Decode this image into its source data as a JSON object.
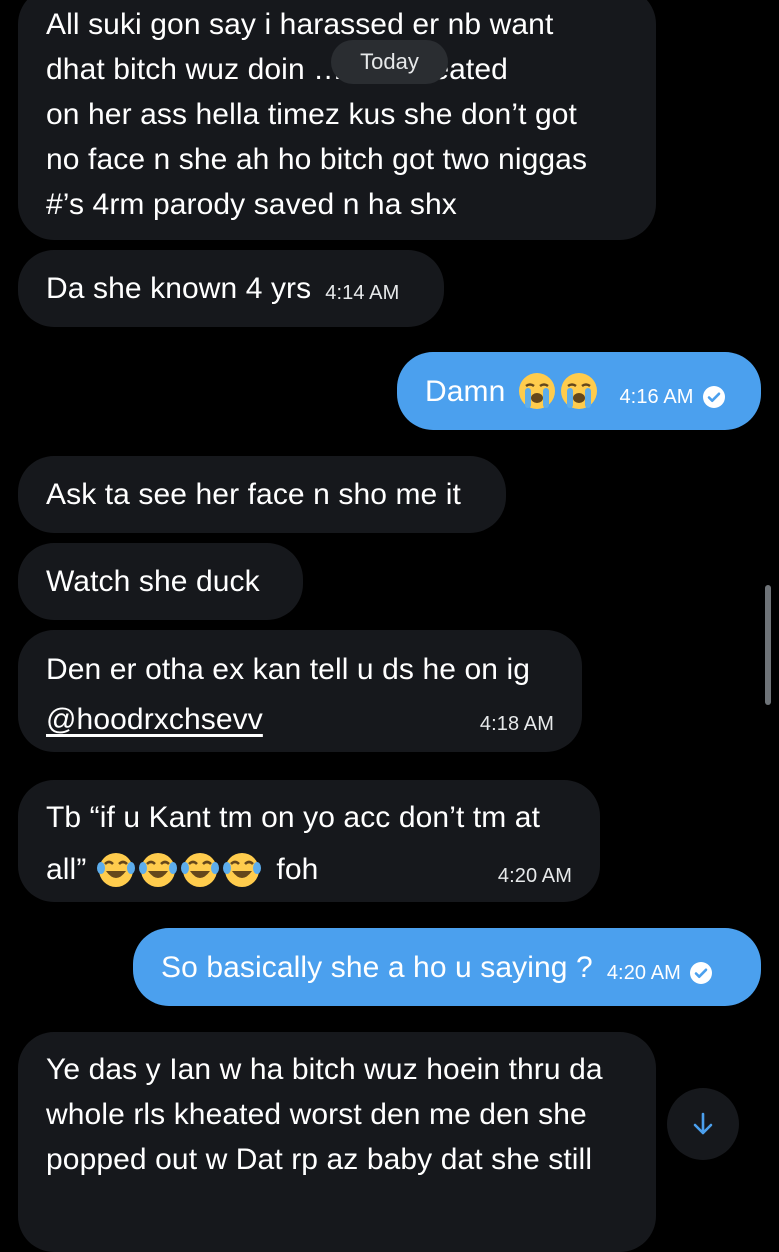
{
  "today_label": "Today",
  "messages": [
    {
      "id": 1,
      "direction": "incoming",
      "lines": [
        "All suki gon say i harassed er nb want",
        "dhat bitch wuz doin … act kheated",
        "on her ass hella timez kus she don’t got",
        "no face n she ah ho bitch got two niggas",
        "#’s 4rm parody saved n ha shx"
      ],
      "time": ""
    },
    {
      "id": 2,
      "direction": "incoming",
      "text": "Da she known 4 yrs",
      "time": "4:14 AM"
    },
    {
      "id": 3,
      "direction": "outgoing",
      "text": "Damn",
      "emojis": [
        "loudly-crying-face",
        "loudly-crying-face"
      ],
      "time": "4:16 AM",
      "status": "sent-check"
    },
    {
      "id": 4,
      "direction": "incoming",
      "text": "Ask ta see her face n sho me it",
      "time": ""
    },
    {
      "id": 5,
      "direction": "incoming",
      "text": "Watch she duck",
      "time": ""
    },
    {
      "id": 6,
      "direction": "incoming",
      "text": "Den er otha ex kan tell u ds he on ig",
      "mention": "@hoodrxchsevv",
      "time": "4:18 AM"
    },
    {
      "id": 7,
      "direction": "incoming",
      "line1": "Tb “if u Kant tm on yo acc don’t tm at",
      "line2_prefix": "all”",
      "emojis": [
        "face-with-tears-of-joy",
        "face-with-tears-of-joy",
        "face-with-tears-of-joy",
        "face-with-tears-of-joy"
      ],
      "line2_suffix": "foh",
      "time": "4:20 AM"
    },
    {
      "id": 8,
      "direction": "outgoing",
      "text": "So basically she a ho u saying ?",
      "time": "4:20 AM",
      "status": "sent-check"
    },
    {
      "id": 9,
      "direction": "incoming",
      "lines": [
        "Ye das y Ian w ha bitch wuz hoein thru da",
        "whole rls kheated worst den me den she",
        "popped out w Dat rp az baby dat she still"
      ],
      "time": ""
    }
  ],
  "colors": {
    "background": "#000000",
    "incoming_bubble": "#16181c",
    "outgoing_bubble": "#4ba0ee",
    "text": "#ffffff"
  },
  "icons": {
    "check": "check-circle-icon",
    "scroll_down": "arrow-down-icon"
  }
}
